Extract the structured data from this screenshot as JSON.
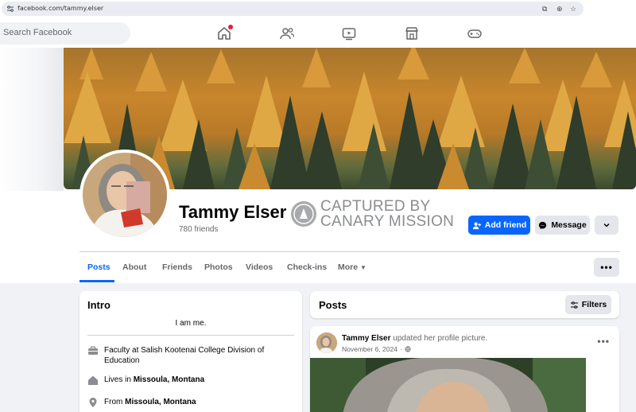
{
  "browser": {
    "url": "facebook.com/tammy.elser",
    "icons": [
      "tune-icon",
      "install-app-icon",
      "zoom-icon",
      "bookmark-star-icon"
    ]
  },
  "nav": {
    "search_placeholder": "Search Facebook",
    "icons": [
      "home-icon",
      "friends-icon",
      "video-icon",
      "marketplace-icon",
      "gaming-icon"
    ],
    "notification_color": "#e41e3f"
  },
  "profile": {
    "name": "Tammy Elser",
    "friends": "780 friends",
    "watermark_line1": "CAPTURED BY",
    "watermark_line2": "CANARY MISSION",
    "add_friend": "Add friend",
    "message": "Message",
    "accent": "#0866ff"
  },
  "tabs": [
    {
      "label": "Posts",
      "active": true
    },
    {
      "label": "About"
    },
    {
      "label": "Friends"
    },
    {
      "label": "Photos"
    },
    {
      "label": "Videos"
    },
    {
      "label": "Check-ins"
    },
    {
      "label": "More"
    }
  ],
  "intro": {
    "title": "Intro",
    "bio": "I am me.",
    "work": "Faculty at Salish Kootenai College Division of Education",
    "lives_prefix": "Lives in ",
    "lives": "Missoula, Montana",
    "from_prefix": "From ",
    "from": "Missoula, Montana"
  },
  "posts": {
    "title": "Posts",
    "filters": "Filters",
    "post": {
      "author": "Tammy Elser",
      "action": " updated her profile picture.",
      "date": "November 6, 2024",
      "privacy_icon": "globe-icon"
    }
  }
}
